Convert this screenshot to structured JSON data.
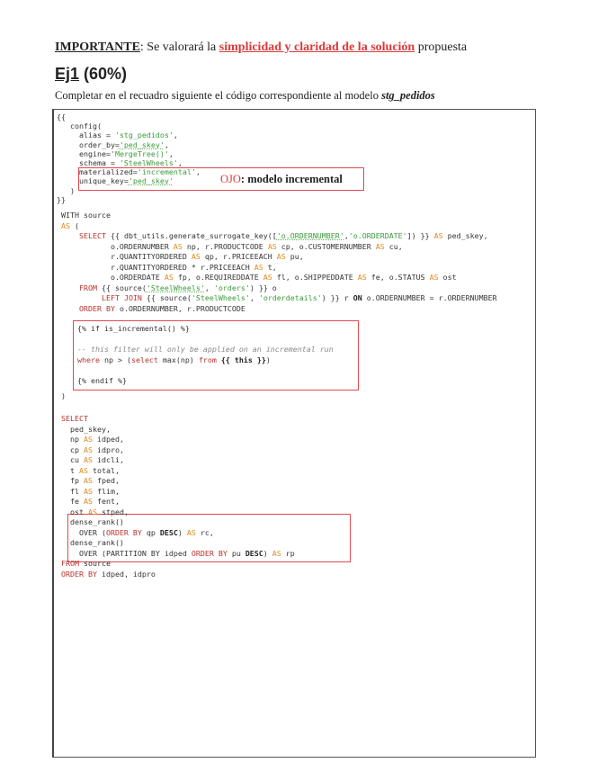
{
  "header": {
    "important_label": "IMPORTANTE",
    "important_pre": ": Se valorará la ",
    "important_highlight": "simplicidad y claridad de la solución",
    "important_post": " propuesta",
    "exercise_number": "Ej1",
    "exercise_weight": " (60%)",
    "instruction": "Completar en el recuadro siguiente el código correspondiente al modelo ",
    "model_name": "stg_pedidos"
  },
  "note": {
    "ojo": "OJO",
    "text": ": modelo incremental"
  },
  "code": {
    "config": [
      [
        [
          "{{",
          ""
        ]
      ],
      [
        [
          "   config(",
          ""
        ]
      ],
      [
        [
          "     alias = ",
          ""
        ],
        [
          "'stg_pedidos'",
          "s2"
        ],
        [
          ",",
          ""
        ]
      ],
      [
        [
          "     order_by=",
          ""
        ],
        [
          "'ped_skey'",
          "s"
        ],
        [
          ",",
          ""
        ]
      ],
      [
        [
          "     engine=",
          ""
        ],
        [
          "'MergeTree()'",
          "s2"
        ],
        [
          ",",
          ""
        ]
      ],
      [
        [
          "     schema = ",
          ""
        ],
        [
          "'SteelWheels'",
          "s2"
        ],
        [
          ",",
          ""
        ]
      ],
      [
        [
          "     materialized=",
          ""
        ],
        [
          "'incremental'",
          "s2"
        ],
        [
          ",",
          ""
        ]
      ],
      [
        [
          "     unique_key=",
          ""
        ],
        [
          "'ped_skey'",
          "s"
        ]
      ],
      [
        [
          "   )",
          ""
        ]
      ],
      [
        [
          "}}",
          ""
        ]
      ]
    ],
    "with": [
      [
        [
          "WITH source",
          ""
        ]
      ],
      [
        [
          "AS",
          "a"
        ],
        [
          " (",
          ""
        ]
      ],
      [
        [
          "    ",
          ""
        ],
        [
          "SELECT",
          "k"
        ],
        [
          " {{ dbt_utils.generate_surrogate_key([",
          ""
        ],
        [
          "'o.ORDERNUMBER'",
          "s"
        ],
        [
          ",",
          ""
        ],
        [
          "'o.ORDERDATE'",
          "s2"
        ],
        [
          "]) }} ",
          ""
        ],
        [
          "AS",
          "a"
        ],
        [
          " ped_skey,",
          ""
        ]
      ],
      [
        [
          "           o.ORDERNUMBER ",
          ""
        ],
        [
          "AS",
          "a"
        ],
        [
          " np, r.PRODUCTCODE ",
          ""
        ],
        [
          "AS",
          "a"
        ],
        [
          " cp, o.CUSTOMERNUMBER ",
          ""
        ],
        [
          "AS",
          "a"
        ],
        [
          " cu,",
          ""
        ]
      ],
      [
        [
          "           r.QUANTITYORDERED ",
          ""
        ],
        [
          "AS",
          "a"
        ],
        [
          " qp, r.PRICEEACH ",
          ""
        ],
        [
          "AS",
          "a"
        ],
        [
          " pu,",
          ""
        ]
      ],
      [
        [
          "           r.QUANTITYORDERED * r.PRICEEACH ",
          ""
        ],
        [
          "AS",
          "a"
        ],
        [
          " t,",
          ""
        ]
      ],
      [
        [
          "           o.ORDERDATE ",
          ""
        ],
        [
          "AS",
          "a"
        ],
        [
          " fp, o.REQUIREDDATE ",
          ""
        ],
        [
          "AS",
          "a"
        ],
        [
          " fl, o.SHIPPEDDATE ",
          ""
        ],
        [
          "AS",
          "a"
        ],
        [
          " fe, o.STATUS ",
          ""
        ],
        [
          "AS",
          "a"
        ],
        [
          " ost",
          ""
        ]
      ],
      [
        [
          "    ",
          ""
        ],
        [
          "FROM",
          "k"
        ],
        [
          " {{ source(",
          ""
        ],
        [
          "'SteelWheels'",
          "s"
        ],
        [
          ", ",
          ""
        ],
        [
          "'orders'",
          "s2"
        ],
        [
          ") }} o",
          ""
        ]
      ],
      [
        [
          "         ",
          ""
        ],
        [
          "LEFT JOIN",
          "k"
        ],
        [
          " {{ source(",
          ""
        ],
        [
          "'SteelWheels'",
          "s2"
        ],
        [
          ", ",
          ""
        ],
        [
          "'orderdetails'",
          "s2"
        ],
        [
          ") }} r ",
          ""
        ],
        [
          "ON",
          "b"
        ],
        [
          " o.ORDERNUMBER = r.ORDERNUMBER",
          ""
        ]
      ],
      [
        [
          "    ",
          ""
        ],
        [
          "ORDER BY",
          "k"
        ],
        [
          " o.ORDERNUMBER, r.PRODUCTCODE",
          ""
        ]
      ]
    ],
    "incremental": [
      [
        [
          "{% if is_incremental() %}",
          ""
        ]
      ],
      [
        [
          "",
          ""
        ]
      ],
      [
        [
          "-- this filter will only be applied on an incremental run",
          "c"
        ]
      ],
      [
        [
          "where",
          "k"
        ],
        [
          " np > (",
          ""
        ],
        [
          "select",
          "k"
        ],
        [
          " max(np) ",
          ""
        ],
        [
          "from",
          "k"
        ],
        [
          " ",
          ""
        ],
        [
          "{{ this }}",
          "b"
        ],
        [
          ")",
          ""
        ]
      ],
      [
        [
          "",
          ""
        ]
      ],
      [
        [
          "{% endif %}",
          ""
        ]
      ]
    ],
    "close": [
      [
        [
          ")",
          ""
        ]
      ]
    ],
    "final": [
      [
        [
          "SELECT",
          "k"
        ]
      ],
      [
        [
          "  ped_skey,",
          ""
        ]
      ],
      [
        [
          "  np ",
          ""
        ],
        [
          "AS",
          "a"
        ],
        [
          " idped,",
          ""
        ]
      ],
      [
        [
          "  cp ",
          ""
        ],
        [
          "AS",
          "a"
        ],
        [
          " idpro,",
          ""
        ]
      ],
      [
        [
          "  cu ",
          ""
        ],
        [
          "AS",
          "a"
        ],
        [
          " idcli,",
          ""
        ]
      ],
      [
        [
          "  t ",
          ""
        ],
        [
          "AS",
          "a"
        ],
        [
          " total,",
          ""
        ]
      ],
      [
        [
          "  fp ",
          ""
        ],
        [
          "AS",
          "a"
        ],
        [
          " fped,",
          ""
        ]
      ],
      [
        [
          "  fl ",
          ""
        ],
        [
          "AS",
          "a"
        ],
        [
          " flim,",
          ""
        ]
      ],
      [
        [
          "  fe ",
          ""
        ],
        [
          "AS",
          "a"
        ],
        [
          " fent,",
          ""
        ]
      ],
      [
        [
          "  ost ",
          ""
        ],
        [
          "AS",
          "a"
        ],
        [
          " stped,",
          ""
        ]
      ],
      [
        [
          "  dense_rank()",
          ""
        ]
      ],
      [
        [
          "    OVER (",
          ""
        ],
        [
          "ORDER BY",
          "k"
        ],
        [
          " qp ",
          ""
        ],
        [
          "DESC",
          "b"
        ],
        [
          ") ",
          ""
        ],
        [
          "AS",
          "a"
        ],
        [
          " rc,",
          ""
        ]
      ],
      [
        [
          "  dense_rank()",
          ""
        ]
      ],
      [
        [
          "    OVER (PARTITION BY idped ",
          ""
        ],
        [
          "ORDER BY",
          "k"
        ],
        [
          " pu ",
          ""
        ],
        [
          "DESC",
          "b"
        ],
        [
          ") ",
          ""
        ],
        [
          "AS",
          "a"
        ],
        [
          " rp",
          ""
        ]
      ],
      [
        [
          "FROM",
          "k"
        ],
        [
          " source",
          ""
        ]
      ],
      [
        [
          "ORDER BY",
          "k"
        ],
        [
          " idped, idpro",
          ""
        ]
      ]
    ]
  }
}
